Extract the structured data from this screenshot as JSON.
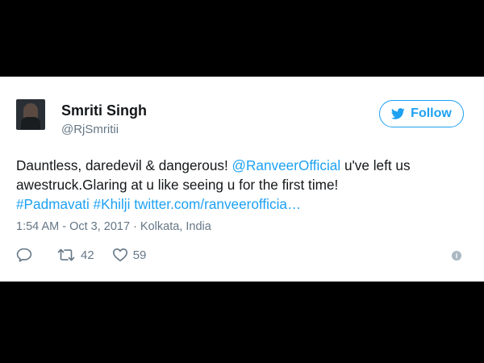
{
  "user": {
    "name": "Smriti Singh",
    "handle": "@RjSmritii"
  },
  "follow": {
    "label": "Follow",
    "icon": "twitter-bird-icon",
    "color": "#1da1f2"
  },
  "tweet": {
    "text_1": "Dauntless, daredevil & dangerous! ",
    "mention": "@RanveerOfficial",
    "text_2": " u've left us awestruck.Glaring at u like seeing u for the first time!",
    "hashtag_1": "#Padmavati",
    "hashtag_2": "#Khilji",
    "link": "twitter.com/ranveerofficia…"
  },
  "meta": {
    "timestamp": "1:54 AM - Oct 3, 2017 · Kolkata, India"
  },
  "actions": {
    "reply_icon": "reply-icon",
    "retweet_icon": "retweet-icon",
    "retweets": "42",
    "like_icon": "heart-icon",
    "likes": "59",
    "info_icon": "info-icon",
    "info_glyph": "i"
  },
  "colors": {
    "background": "#000000",
    "card": "#ffffff",
    "text": "#14171a",
    "secondary": "#657786",
    "link": "#1da1f2"
  }
}
